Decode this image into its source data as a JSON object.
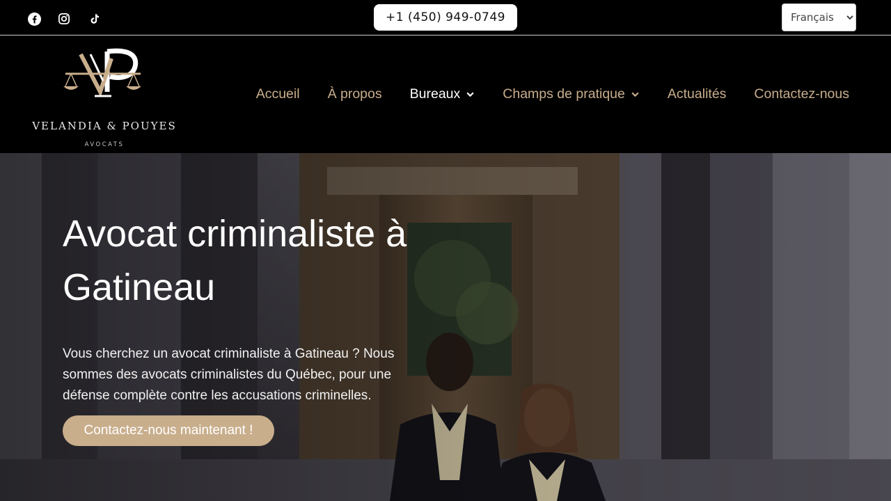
{
  "topbar": {
    "social": [
      {
        "icon": "facebook-icon"
      },
      {
        "icon": "instagram-icon"
      },
      {
        "icon": "tiktok-icon"
      }
    ],
    "phone": "+1 (450) 949-0749",
    "language": {
      "selected": "Français"
    }
  },
  "header": {
    "logo": {
      "name": "VELANDIA & POUYES",
      "subtitle": "AVOCATS"
    },
    "nav": {
      "home": "Accueil",
      "about": "À propos",
      "offices": "Bureaux",
      "practice": "Champs de pratique",
      "news": "Actualités",
      "contact": "Contactez-nous"
    }
  },
  "hero": {
    "title_line1": "Avocat criminaliste à",
    "title_line2": "Gatineau",
    "description": "Vous cherchez un avocat criminaliste à Gatineau ? Nous sommes des avocats criminalistes du Québec, pour une défense complète contre les accusations criminelles.",
    "cta": "Contactez-nous maintenant !"
  },
  "colors": {
    "accent": "#c9ae8c",
    "background": "#000000"
  }
}
